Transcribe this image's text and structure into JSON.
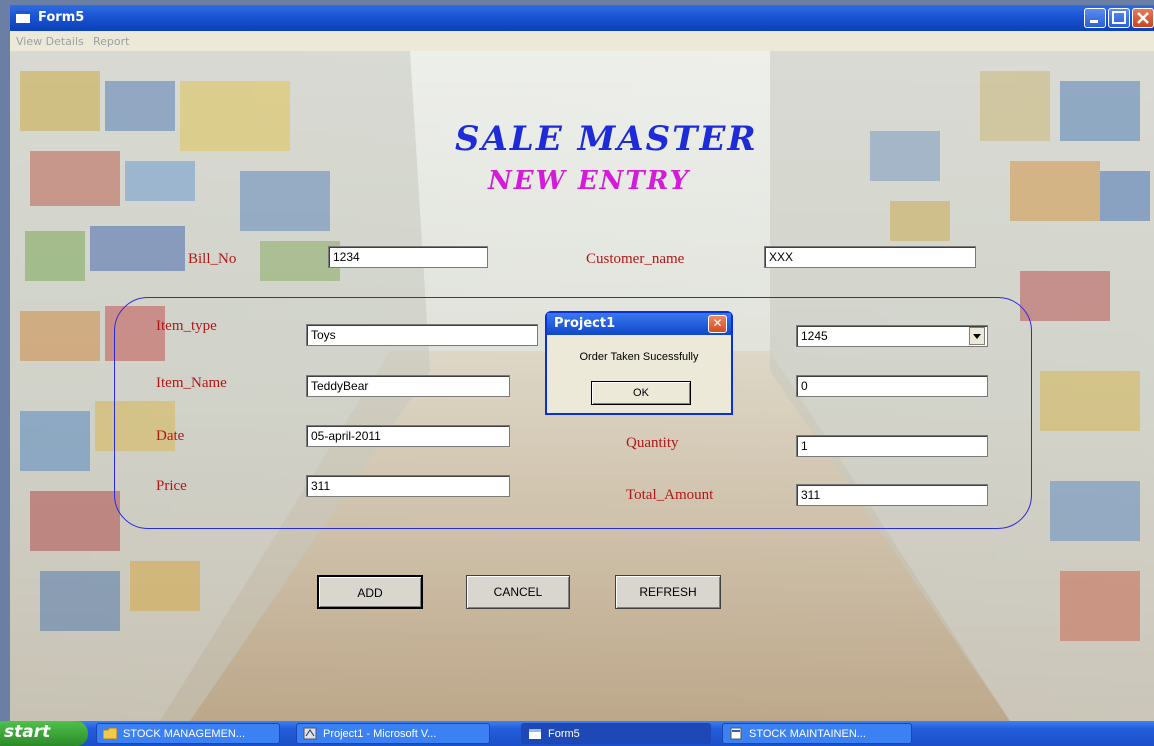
{
  "window": {
    "title": "Form5"
  },
  "menu": [
    "View Details",
    "Report"
  ],
  "form": {
    "heading": "SALE MASTER",
    "subheading": "NEW ENTRY",
    "bill_no_label": "Bill_No",
    "bill_no_value": "1234",
    "customer_name_label": "Customer_name",
    "customer_name_value": "XXX",
    "item_type_label": "Item_type",
    "item_type_value": "Toys",
    "item_name_label": "Item_Name",
    "item_name_value": "TeddyBear",
    "date_label": "Date",
    "date_value": "05-april-2011",
    "price_label": "Price",
    "price_value": "311",
    "item_code_value": "1245",
    "stock_value": "0",
    "quantity_label": "Quantity",
    "quantity_value": "1",
    "total_amount_label": "Total_Amount",
    "total_amount_value": "311",
    "add_label": "ADD",
    "cancel_label": "CANCEL",
    "refresh_label": "REFRESH"
  },
  "dialog": {
    "title": "Project1",
    "message": "Order Taken Sucessfully",
    "ok_label": "OK",
    "close_glyph": "✕"
  },
  "taskbar": {
    "start_label": "start",
    "items": [
      {
        "label": "STOCK MANAGEMEN...",
        "icon": "folder-icon"
      },
      {
        "label": "Project1 - Microsoft V...",
        "icon": "vb-icon"
      },
      {
        "label": "Form5",
        "icon": "form-icon",
        "active": true
      },
      {
        "label": "STOCK MAINTAINEN...",
        "icon": "document-icon"
      }
    ]
  },
  "colors": {
    "label_red": "#b01818",
    "title_blue": "#1e2bd9",
    "subtitle_magenta": "#d31bd9",
    "frame_blue": "#2a2ae0"
  }
}
